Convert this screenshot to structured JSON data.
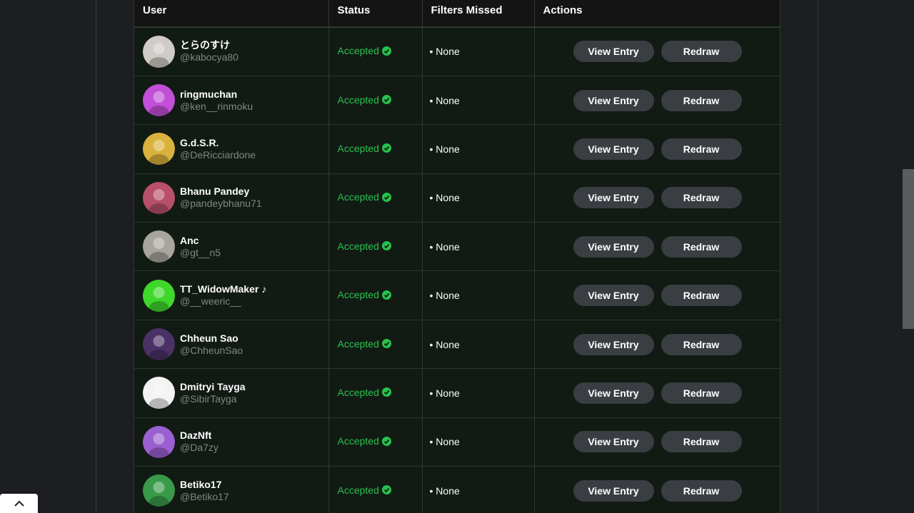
{
  "table": {
    "headers": {
      "user": "User",
      "status": "Status",
      "filters": "Filters Missed",
      "actions": "Actions"
    },
    "rows": [
      {
        "display_name": "とらのすけ",
        "handle": "@kabocya80",
        "status": "Accepted",
        "filters": "• None",
        "view_label": "View Entry",
        "redraw_label": "Redraw",
        "avatar_color": "#cfcbc6"
      },
      {
        "display_name": "ringmuchan",
        "handle": "@ken__rinmoku",
        "status": "Accepted",
        "filters": "• None",
        "view_label": "View Entry",
        "redraw_label": "Redraw",
        "avatar_color": "#c24fd8"
      },
      {
        "display_name": "G.d.S.R.",
        "handle": "@DeRicciardone",
        "status": "Accepted",
        "filters": "• None",
        "view_label": "View Entry",
        "redraw_label": "Redraw",
        "avatar_color": "#d9b23d"
      },
      {
        "display_name": "Bhanu Pandey",
        "handle": "@pandeybhanu71",
        "status": "Accepted",
        "filters": "• None",
        "view_label": "View Entry",
        "redraw_label": "Redraw",
        "avatar_color": "#b8506a"
      },
      {
        "display_name": "Anc",
        "handle": "@gt__n5",
        "status": "Accepted",
        "filters": "• None",
        "view_label": "View Entry",
        "redraw_label": "Redraw",
        "avatar_color": "#a8a59d"
      },
      {
        "display_name": "TT_WidowMaker ♪",
        "handle": "@__weeric__",
        "status": "Accepted",
        "filters": "• None",
        "view_label": "View Entry",
        "redraw_label": "Redraw",
        "avatar_color": "#3ed72a"
      },
      {
        "display_name": "Chheun Sao",
        "handle": "@ChheunSao",
        "status": "Accepted",
        "filters": "• None",
        "view_label": "View Entry",
        "redraw_label": "Redraw",
        "avatar_color": "#4a3166"
      },
      {
        "display_name": "Dmitryi Tayga",
        "handle": "@SibirTayga",
        "status": "Accepted",
        "filters": "• None",
        "view_label": "View Entry",
        "redraw_label": "Redraw",
        "avatar_color": "#f3f3f3"
      },
      {
        "display_name": "DazNft",
        "handle": "@Da7zy",
        "status": "Accepted",
        "filters": "• None",
        "view_label": "View Entry",
        "redraw_label": "Redraw",
        "avatar_color": "#9a5fd0"
      },
      {
        "display_name": "Betiko17",
        "handle": "@Betiko17",
        "status": "Accepted",
        "filters": "• None",
        "view_label": "View Entry",
        "redraw_label": "Redraw",
        "avatar_color": "#3a9a4a"
      }
    ]
  },
  "colors": {
    "accepted": "#27c24c",
    "button_bg": "#3a3d42",
    "table_bg": "#121a14"
  },
  "icons": {
    "status": "check-circle-icon",
    "back_to_top": "chevron-up-icon"
  }
}
